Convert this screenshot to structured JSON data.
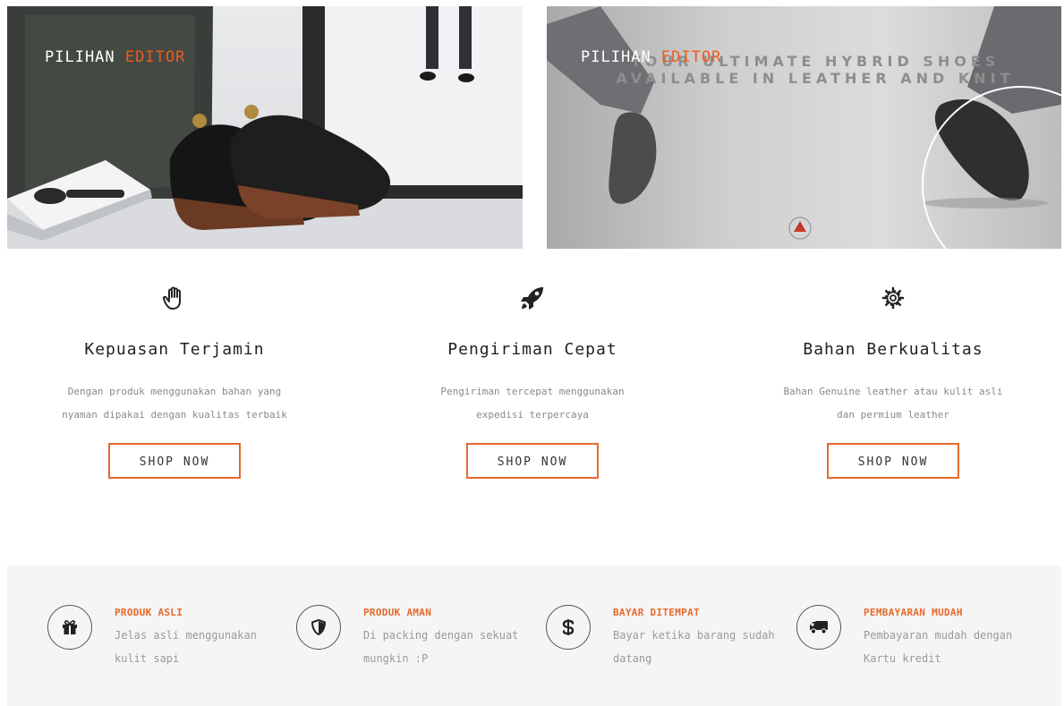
{
  "banners": [
    {
      "label_main": "PILIHAN ",
      "label_accent": "EDITOR"
    },
    {
      "label_main": "PILIHAN ",
      "label_accent": "EDITOR",
      "promo_line1": "YOUR ULTIMATE HYBRID SHOES",
      "promo_line2": "AVAILABLE IN LEATHER AND KNIT"
    }
  ],
  "features": [
    {
      "icon": "hand-icon",
      "title": "Kepuasan Terjamin",
      "desc": "Dengan produk menggunakan bahan yang nyaman dipakai dengan kualitas terbaik",
      "button": "SHOP NOW"
    },
    {
      "icon": "rocket-icon",
      "title": "Pengiriman Cepat",
      "desc": "Pengiriman tercepat menggunakan expedisi terpercaya",
      "button": "SHOP NOW"
    },
    {
      "icon": "gear-icon",
      "title": "Bahan Berkualitas",
      "desc": "Bahan Genuine leather atau kulit asli dan permium leather",
      "button": "SHOP NOW"
    }
  ],
  "benefits": [
    {
      "icon": "gift-icon",
      "title": "PRODUK ASLI",
      "desc": "Jelas asli menggunakan kulit sapi"
    },
    {
      "icon": "shield-icon",
      "title": "PRODUK AMAN",
      "desc": "Di packing dengan sekuat mungkin :P"
    },
    {
      "icon": "dollar-icon",
      "title": "BAYAR DITEMPAT",
      "desc": "Bayar ketika barang sudah datang"
    },
    {
      "icon": "truck-icon",
      "title": "PEMBAYARAN MUDAH",
      "desc": "Pembayaran mudah dengan Kartu kredit"
    }
  ],
  "colors": {
    "accent": "#e8692b",
    "strip_background": "#f5f5f5"
  }
}
